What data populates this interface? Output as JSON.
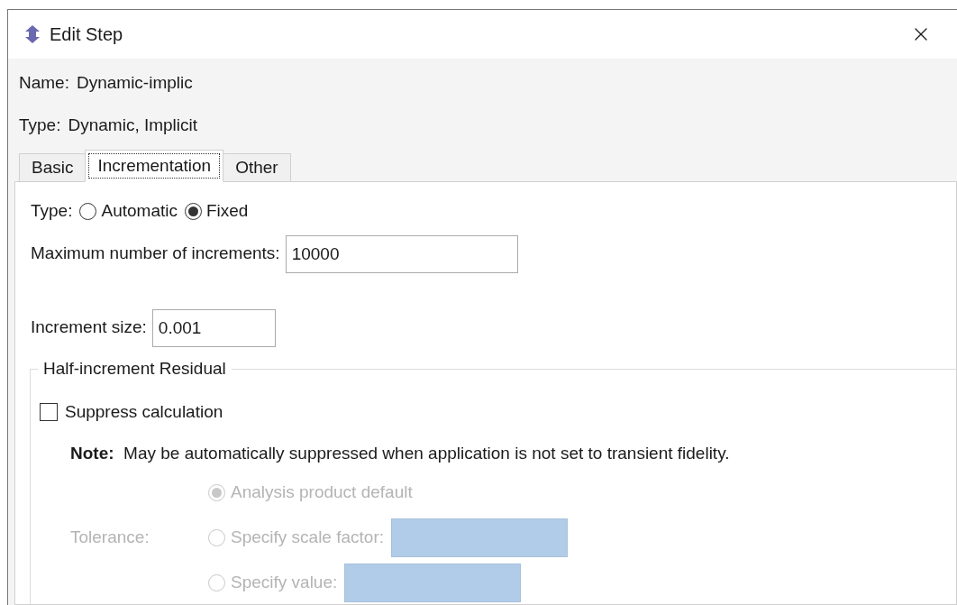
{
  "window": {
    "title": "Edit Step"
  },
  "name": {
    "label": "Name:",
    "value": "Dynamic-implic"
  },
  "type": {
    "label": "Type:",
    "value": "Dynamic, Implicit"
  },
  "tabs": [
    {
      "label": "Basic",
      "selected": false
    },
    {
      "label": "Incrementation",
      "selected": true
    },
    {
      "label": "Other",
      "selected": false
    }
  ],
  "incrementation": {
    "type": {
      "label": "Type:",
      "options": [
        {
          "label": "Automatic",
          "selected": false
        },
        {
          "label": "Fixed",
          "selected": true
        }
      ]
    },
    "max_increments": {
      "label": "Maximum number of increments:",
      "value": "10000"
    },
    "increment_size": {
      "label": "Increment size:",
      "value": "0.001"
    },
    "half_increment_residual": {
      "title": "Half-increment Residual",
      "suppress": {
        "label": "Suppress calculation",
        "checked": false
      },
      "note": "**Note:**  May be automatically suppressed when application is not set to transient fidelity.",
      "tolerance": {
        "label": "Tolerance:",
        "disabled": true,
        "options": [
          {
            "label": "Analysis product default",
            "selected": true,
            "kind": "plain"
          },
          {
            "label": "Specify scale factor:",
            "selected": false,
            "kind": "field"
          },
          {
            "label": "Specify value:",
            "selected": false,
            "kind": "field"
          }
        ]
      }
    }
  }
}
